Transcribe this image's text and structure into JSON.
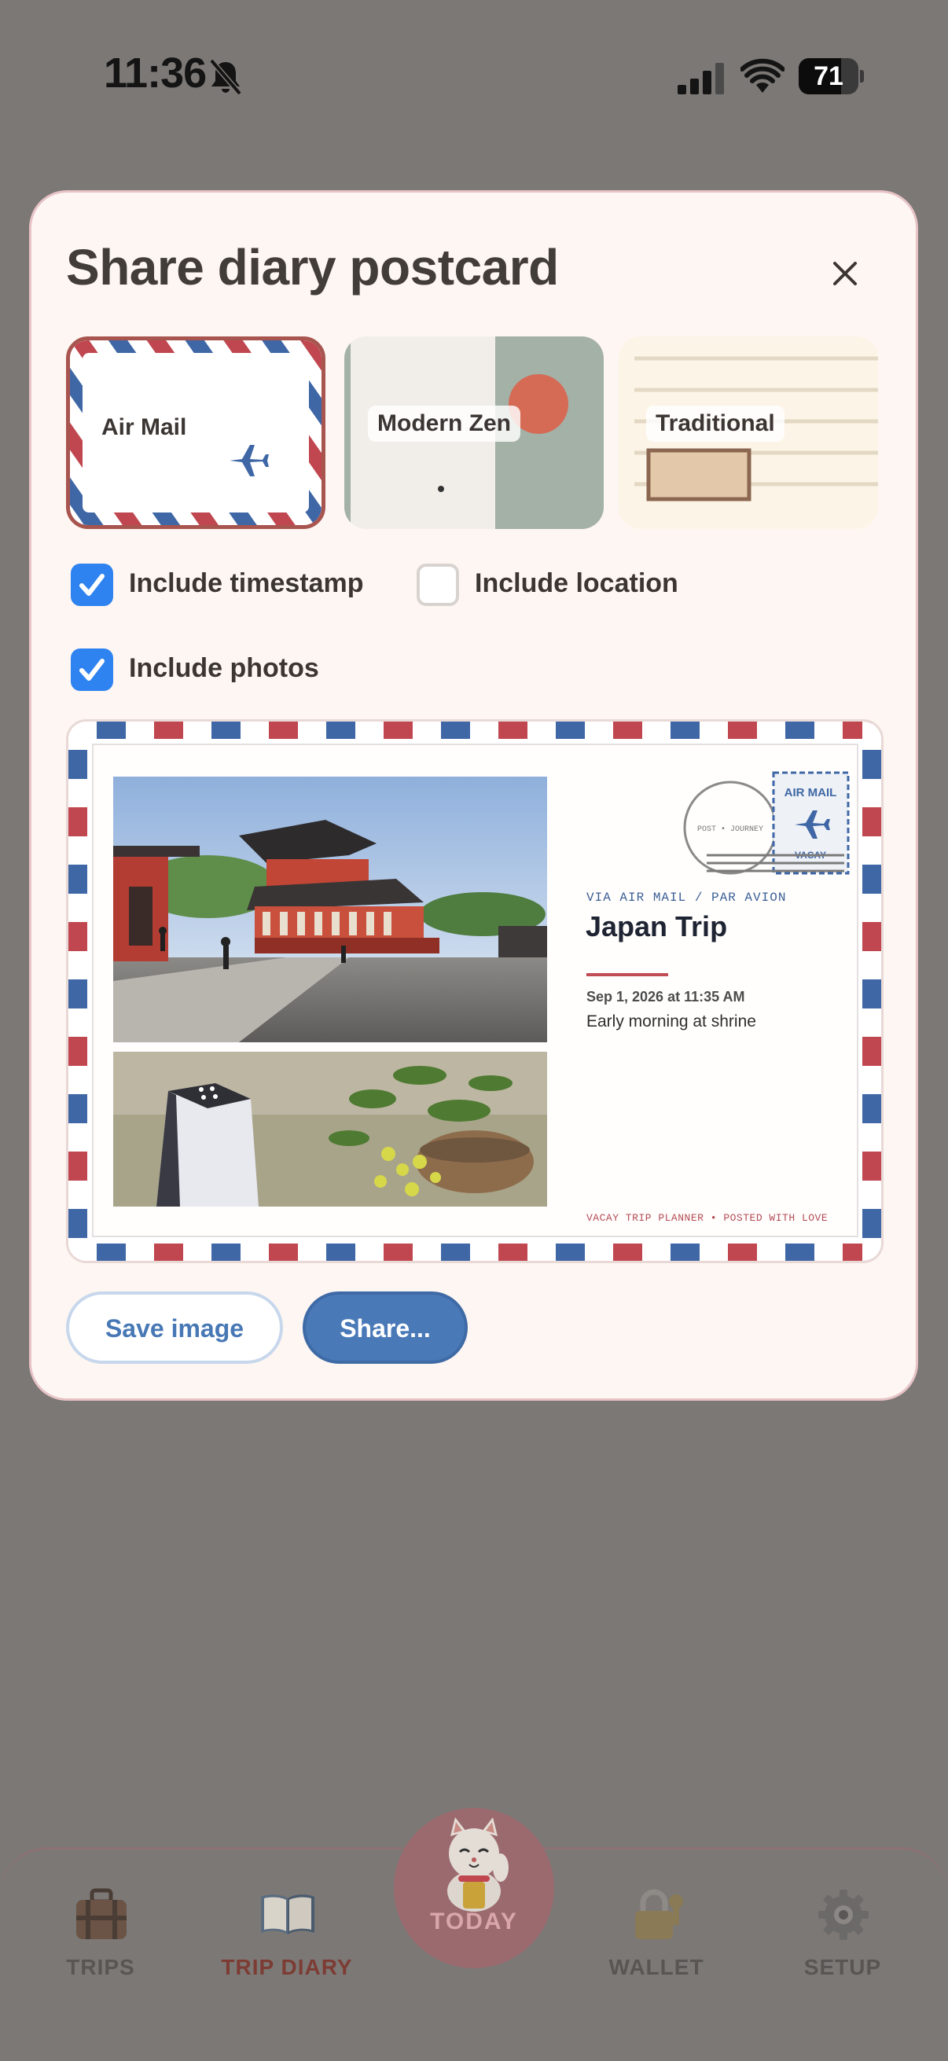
{
  "status_bar": {
    "time": "11:36",
    "battery": "71",
    "battery_level": 0.71
  },
  "modal": {
    "title": "Share diary postcard",
    "close_label": "×"
  },
  "templates": [
    {
      "label": "Air Mail",
      "selected": true
    },
    {
      "label": "Modern Zen",
      "selected": false
    },
    {
      "label": "Traditional",
      "selected": false
    }
  ],
  "options": {
    "timestamp": {
      "label": "Include timestamp",
      "checked": true
    },
    "location": {
      "label": "Include location",
      "checked": false
    },
    "photos": {
      "label": "Include photos",
      "checked": true
    }
  },
  "postcard": {
    "stamp_top": "AIR MAIL",
    "stamp_bottom": "VACAY",
    "postmark": "POST • JOURNEY",
    "via": "VIA AIR MAIL / PAR AVION",
    "trip_title": "Japan Trip",
    "timestamp": "Sep 1, 2026 at 11:35 AM",
    "entry": "Early morning at shrine",
    "footer": "VACAY TRIP PLANNER • POSTED WITH LOVE"
  },
  "actions": {
    "save": "Save image",
    "share": "Share..."
  },
  "nav": {
    "trips": "TRIPS",
    "diary": "TRIP DIARY",
    "today": "TODAY",
    "wallet": "WALLET",
    "setup": "SETUP",
    "active": "diary"
  },
  "colors": {
    "airmail_red": "#c0474f",
    "airmail_blue": "#3f67a6",
    "checkbox_blue": "#2f83f0",
    "share_button": "#4a79b8",
    "modal_bg": "#fdf6f2"
  }
}
